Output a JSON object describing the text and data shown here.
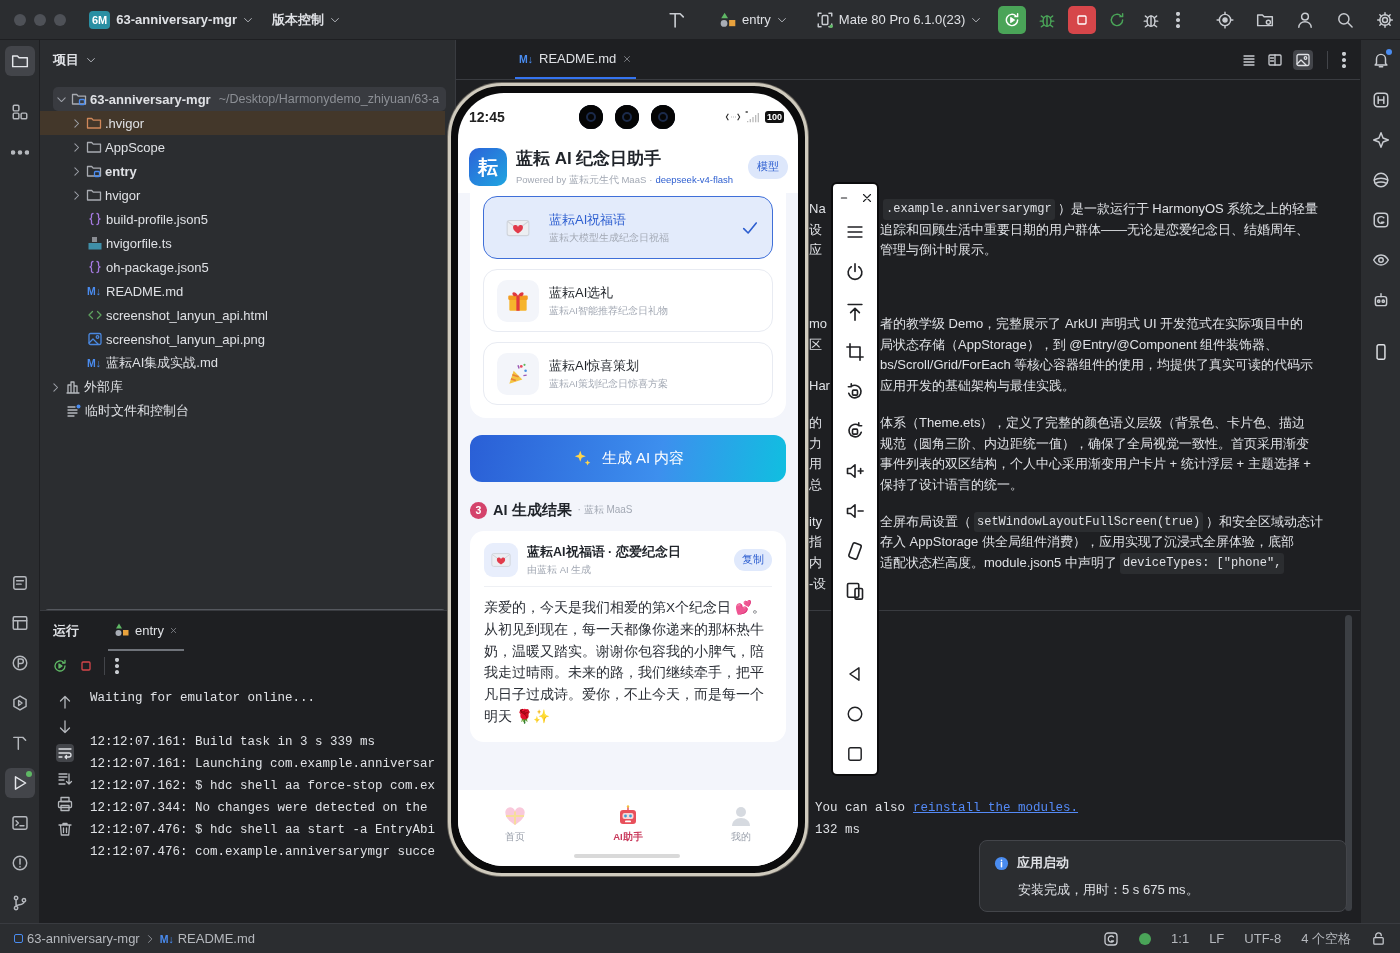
{
  "title_bar": {
    "project_badge": "6M",
    "project": "63-anniversary-mgr",
    "vcs": "版本控制",
    "run_config": "entry",
    "device": "Mate 80 Pro 6.1.0(23)"
  },
  "left_rail": [
    {
      "kind": "project",
      "selected": true
    },
    {
      "kind": "structure",
      "selected": false
    },
    {
      "kind": "more",
      "selected": false
    }
  ],
  "left_rail_bottom": [
    {
      "kind": "bookmarks",
      "selected": false
    },
    {
      "kind": "layout",
      "selected": false
    },
    {
      "kind": "profiler",
      "selected": false
    },
    {
      "kind": "services",
      "selected": false
    },
    {
      "kind": "build",
      "selected": false
    },
    {
      "kind": "run",
      "selected": true
    },
    {
      "kind": "terminal",
      "selected": false
    },
    {
      "kind": "problems",
      "selected": false
    },
    {
      "kind": "git",
      "selected": false
    }
  ],
  "project_panel": {
    "title": "项目",
    "root": {
      "name": "63-anniversary-mgr",
      "path": "~/Desktop/Harmonydemo_zhiyuan/63-a",
      "expanded": true,
      "children": [
        {
          "name": ".hvigor",
          "kind": "excluded-folder",
          "expanded": false,
          "selected": true
        },
        {
          "name": "AppScope",
          "kind": "folder",
          "expanded": false,
          "selected": false
        },
        {
          "name": "entry",
          "kind": "module",
          "expanded": false,
          "selected": false
        },
        {
          "name": "hvigor",
          "kind": "folder",
          "expanded": false,
          "selected": false
        },
        {
          "name": "build-profile.json5",
          "kind": "json5",
          "selected": false
        },
        {
          "name": "hvigorfile.ts",
          "kind": "ts",
          "selected": false
        },
        {
          "name": "oh-package.json5",
          "kind": "json5",
          "selected": false
        },
        {
          "name": "README.md",
          "kind": "markdown",
          "badge": "M↓",
          "selected": false
        },
        {
          "name": "screenshot_lanyun_api.html",
          "kind": "html",
          "selected": false
        },
        {
          "name": "screenshot_lanyun_api.png",
          "kind": "image",
          "selected": false
        },
        {
          "name": "蓝耘AI集成实战.md",
          "kind": "markdown",
          "badge": "M↓",
          "selected": false
        }
      ]
    },
    "extras": [
      {
        "name": "外部库",
        "kind": "library",
        "expanded": false,
        "selected": false
      },
      {
        "name": "临时文件和控制台",
        "kind": "scratch",
        "selected": false
      }
    ]
  },
  "editor": {
    "tab": {
      "badge": "M↓",
      "name": "README.md"
    },
    "paragraphs": [
      [
        {
          "fragment": "Na",
          "parts": [
            {
              "kind": "code",
              "text": ".example.anniversarymgr"
            },
            {
              "kind": "text",
              "text": "）是一款运行于 HarmonyOS 系统之上的轻量"
            }
          ]
        },
        {
          "fragment": "设",
          "parts": [
            {
              "kind": "text",
              "text": "追踪和回顾生活中重要日期的用户群体——无论是恋爱纪念日、结婚周年、"
            }
          ]
        },
        {
          "fragment": "应",
          "parts": [
            {
              "kind": "text",
              "text": "管理与倒计时展示。"
            }
          ]
        }
      ],
      [
        {
          "fragment": "mo",
          "parts": [
            {
              "kind": "text",
              "text": "者的教学级 Demo，完整展示了 ArkUI 声明式 UI 开发范式在实际项目中的"
            }
          ]
        },
        {
          "fragment": "区",
          "parts": [
            {
              "kind": "text",
              "text": "局状态存储（AppStorage），到 @Entry/@Component 组件装饰器、"
            }
          ]
        },
        {
          "parts": [
            {
              "kind": "text",
              "text": "bs/Scroll/Grid/ForEach 等核心容器组件的使用，均提供了真实可读的代码示"
            }
          ]
        },
        {
          "fragment": "Har",
          "parts": [
            {
              "kind": "text",
              "text": "应用开发的基础架构与最佳实践。"
            }
          ]
        }
      ],
      [
        {
          "fragment": "的",
          "parts": [
            {
              "kind": "text",
              "text": "体系（Theme.ets），定义了完整的颜色语义层级（背景色、卡片色、描边"
            }
          ]
        },
        {
          "fragment": "力",
          "parts": [
            {
              "kind": "text",
              "text": "规范（圆角三阶、内边距统一值），确保了全局视觉一致性。首页采用渐变"
            }
          ]
        },
        {
          "fragment": "用",
          "parts": [
            {
              "kind": "text",
              "text": "事件列表的双区结构，个人中心采用渐变用户卡片 + 统计浮层 + 主题选择 +"
            }
          ]
        },
        {
          "fragment": "总",
          "parts": [
            {
              "kind": "text",
              "text": "保持了设计语言的统一。"
            }
          ]
        }
      ],
      [
        {
          "fragment": "ity",
          "parts": [
            {
              "kind": "text",
              "text": "全屏布局设置（"
            },
            {
              "kind": "code",
              "text": "setWindowLayoutFullScreen(true)"
            },
            {
              "kind": "text",
              "text": "）和安全区域动态计"
            }
          ]
        },
        {
          "fragment": "指",
          "parts": [
            {
              "kind": "text",
              "text": "存入 AppStorage 供全局组件消费），应用实现了沉浸式全屏体验，底部"
            }
          ]
        },
        {
          "fragment": "内",
          "parts": [
            {
              "kind": "text",
              "text": "适配状态栏高度。module.json5 中声明了"
            },
            {
              "kind": "code",
              "text": "deviceTypes: [\"phone\","
            }
          ]
        },
        {
          "fragment": "-设"
        }
      ]
    ]
  },
  "run_panel": {
    "title": "运行",
    "tab": "entry",
    "blocks": [
      [
        {
          "text": "Waiting for emulator online..."
        }
      ],
      [
        {
          "text": "12:12:07.161: Build task in 3 s 339 ms"
        },
        {
          "text": "12:12:07.161: Launching com.example.anniversar"
        },
        {
          "text": "12:12:07.162: $ hdc shell aa force-stop com.ex"
        },
        {
          "text": "12:12:07.344: No changes were detected on the",
          "right": [
            {
              "kind": "text",
              "text": "You can also"
            },
            {
              "kind": "link",
              "text": "reinstall the modules."
            }
          ]
        },
        {
          "text": "12:12:07.476: $ hdc shell aa start -a EntryAbi",
          "right": [
            {
              "kind": "text",
              "text": "132 ms"
            }
          ]
        },
        {
          "text": "12:12:07.476: com.example.anniversarymgr succe"
        }
      ]
    ]
  },
  "status_bar": {
    "breadcrumb": [
      {
        "kind": "module",
        "text": "63-anniversary-mgr"
      },
      {
        "kind": "markdown",
        "badge": "M↓",
        "text": "README.md"
      }
    ],
    "items": [
      "1:1",
      "LF",
      "UTF-8",
      "4 个空格"
    ]
  },
  "notification": {
    "title": "应用启动",
    "message": "安装完成，用时：5 s 675 ms。"
  },
  "phone": {
    "status": {
      "time": "12:45",
      "battery": "100"
    },
    "header": {
      "logo": "耘",
      "title": "蓝耘 AI 纪念日助手",
      "powered": "Powered by 蓝耘元生代 MaaS",
      "separator": "·",
      "model": "deepseek-v4-flash",
      "model_button": "模型"
    },
    "options": [
      {
        "kind": "greeting",
        "title": "蓝耘AI祝福语",
        "subtitle": "蓝耘大模型生成纪念日祝福",
        "selected": true
      },
      {
        "kind": "gift",
        "title": "蓝耘AI选礼",
        "subtitle": "蓝耘AI智能推荐纪念日礼物",
        "selected": false
      },
      {
        "kind": "surprise",
        "title": "蓝耘AI惊喜策划",
        "subtitle": "蓝耘AI策划纪念日惊喜方案",
        "selected": false
      }
    ],
    "generate_button": "生成 AI 内容",
    "result": {
      "step": "3",
      "title": "AI 生成结果",
      "source": "· 蓝耘 MaaS",
      "card": {
        "kind": "greeting",
        "title": "蓝耘AI祝福语 · 恋爱纪念日",
        "subtitle": "由蓝耘 AI 生成",
        "copy_button": "复制",
        "body": "亲爱的，今天是我们相爱的第X个纪念日 💕。从初见到现在，每一天都像你递来的那杯热牛奶，温暖又踏实。谢谢你包容我的小脾气，陪我走过晴雨。未来的路，我们继续牵手，把平凡日子过成诗。爱你，不止今天，而是每一个明天 🌹✨"
      }
    },
    "tabs": [
      {
        "kind": "home",
        "label": "首页",
        "selected": false
      },
      {
        "kind": "assistant",
        "label": "AI助手",
        "selected": true
      },
      {
        "kind": "profile",
        "label": "我的",
        "selected": false
      }
    ]
  }
}
